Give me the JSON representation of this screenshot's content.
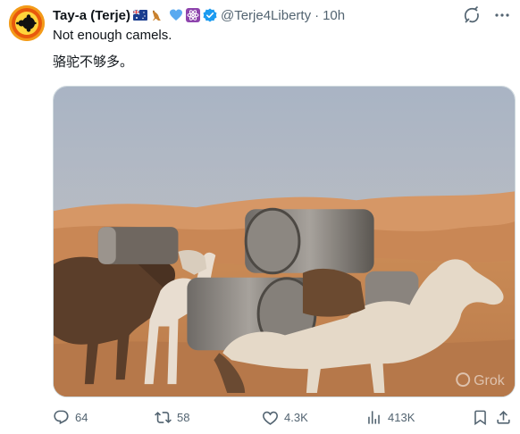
{
  "author": {
    "display_name": "Tay-a (Terje)",
    "handle": "@Terje4Liberty",
    "separator": "·",
    "time": "10h"
  },
  "header_emojis": [
    "australia-flag-icon",
    "kangaroo-icon",
    "blue-heart-icon",
    "atom-icon",
    "verified-badge-icon"
  ],
  "tweet": {
    "line1": "Not enough camels.",
    "line2": "骆驼不够多。"
  },
  "media": {
    "description_icons": "camels-carrying-barrels-image",
    "watermark": "Grok"
  },
  "actions": {
    "replies": "64",
    "reposts": "58",
    "likes": "4.3K",
    "views": "413K"
  },
  "colors": {
    "text": "#0f1419",
    "muted": "#536471",
    "verified": "#1d9bf0"
  }
}
